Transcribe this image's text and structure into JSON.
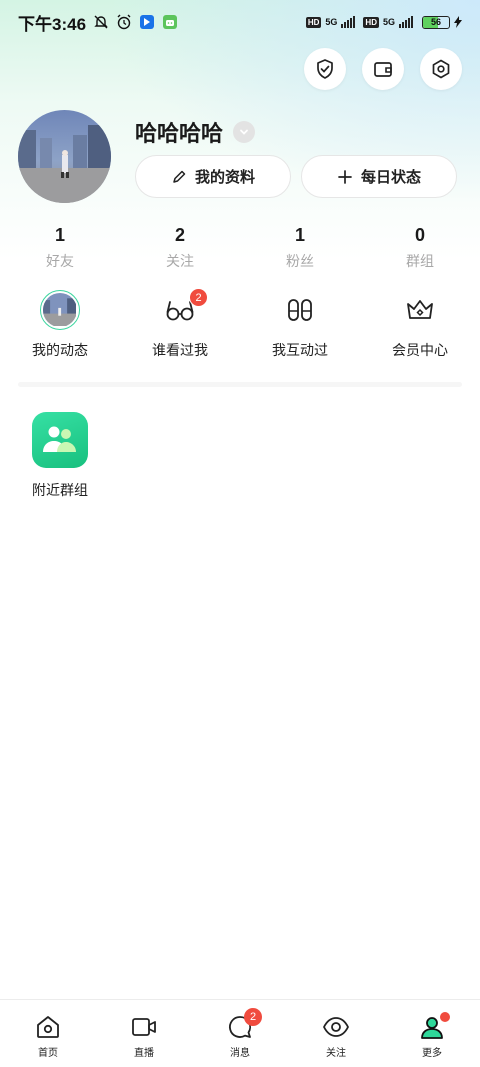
{
  "status_bar": {
    "time": "下午3:46",
    "hd1": "HD",
    "net1": "5G",
    "hd2": "HD",
    "net2": "5G",
    "battery": "56",
    "battery_level": 0.56,
    "icons": [
      "mute-bell-icon",
      "alarm-icon",
      "app-notification-icon",
      "android-icon",
      "charging-icon"
    ]
  },
  "top_actions": [
    {
      "icon": "shield-icon"
    },
    {
      "icon": "wallet-icon"
    },
    {
      "icon": "settings-hexagon-icon"
    }
  ],
  "profile": {
    "username": "哈哈哈哈",
    "edit_profile_label": "我的资料",
    "daily_status_label": "每日状态"
  },
  "stats": [
    {
      "value": "1",
      "label": "好友"
    },
    {
      "value": "2",
      "label": "关注"
    },
    {
      "value": "1",
      "label": "粉丝"
    },
    {
      "value": "0",
      "label": "群组"
    }
  ],
  "quick_actions": [
    {
      "label": "我的动态",
      "icon": "my-moments-thumbnail"
    },
    {
      "label": "谁看过我",
      "icon": "glasses-icon",
      "badge": "2"
    },
    {
      "label": "我互动过",
      "icon": "footprints-icon"
    },
    {
      "label": "会员中心",
      "icon": "crown-icon"
    }
  ],
  "tiles": [
    {
      "label": "附近群组",
      "icon": "nearby-groups-icon"
    }
  ],
  "bottom_nav": [
    {
      "label": "首页",
      "icon": "home-icon"
    },
    {
      "label": "直播",
      "icon": "video-camera-icon"
    },
    {
      "label": "消息",
      "icon": "message-bubble-icon",
      "badge": "2"
    },
    {
      "label": "关注",
      "icon": "eye-icon"
    },
    {
      "label": "更多",
      "icon": "person-icon",
      "active": true,
      "dot": true
    }
  ],
  "colors": {
    "accent": "#1fd18c",
    "badge": "#f04b3e"
  }
}
